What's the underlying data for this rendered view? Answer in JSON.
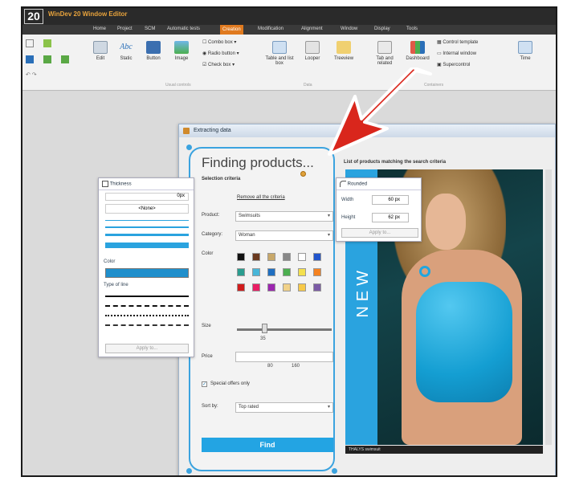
{
  "app": {
    "logo": "20",
    "title": "WinDev 20 Window Editor"
  },
  "menu": {
    "items": [
      "Home",
      "Project",
      "SCM",
      "Automatic tests",
      "Creation",
      "Modification",
      "Alignment",
      "Window",
      "Display",
      "Tools"
    ],
    "active": "Creation"
  },
  "ribbon": {
    "buttons": {
      "edit": "Edit",
      "static": "Static",
      "button": "Button",
      "image": "Image",
      "combo": "Combo box",
      "radio": "Radio button",
      "check": "Check box",
      "table": "Table and list box",
      "looper": "Looper",
      "treeview": "Treeview",
      "tab": "Tab and related",
      "dashboard": "Dashboard",
      "time": "Time",
      "control_template": "Control template",
      "internal_window": "Internal window",
      "supercontrol": "Supercontrol"
    },
    "groups": {
      "usual": "Usual controls",
      "data": "Data",
      "containers": "Containers"
    }
  },
  "window": {
    "title": "Extracting data",
    "form": {
      "title": "Finding products...",
      "selection": "Selection criteria",
      "remove_link": "Remove all the criteria",
      "product_label": "Product:",
      "product_value": "Swimsuits",
      "category_label": "Category:",
      "category_value": "Woman",
      "color_label": "Color",
      "size_label": "Size",
      "size_value": "35",
      "price_label": "Price",
      "price_min": "80",
      "price_max": "160",
      "special_label": "Special offers only",
      "sort_label": "Sort by:",
      "sort_value": "Top rated",
      "find_button": "Find"
    },
    "list_header": "List of products matching the search criteria",
    "banner": "NEW",
    "caption": "THALYS swimsuit"
  },
  "thickness_panel": {
    "title": "Thickness",
    "value": "0px",
    "none": "<None>",
    "color_label": "Color",
    "type_label": "Type of line",
    "apply": "Apply to..."
  },
  "rounded_panel": {
    "title": "Rounded",
    "width_label": "Width",
    "width_value": "60 px",
    "height_label": "Height",
    "height_value": "62 px",
    "apply": "Apply to..."
  },
  "colors": {
    "accent": "#23a4e3",
    "menu_active": "#e07a1f",
    "arrow": "#d9261c"
  },
  "swatches": [
    "#111111",
    "#6b3a1f",
    "#c8a86a",
    "#888888",
    "#ffffff",
    "#2255cc",
    "#2a9d8f",
    "#48b6d8",
    "#1f6fc1",
    "#4caf50",
    "#f4e04d",
    "#f58220",
    "#d01c1c",
    "#e91e63",
    "#9c27b0",
    "#f1d28a",
    "#f7c948",
    "#7b5ba6"
  ]
}
